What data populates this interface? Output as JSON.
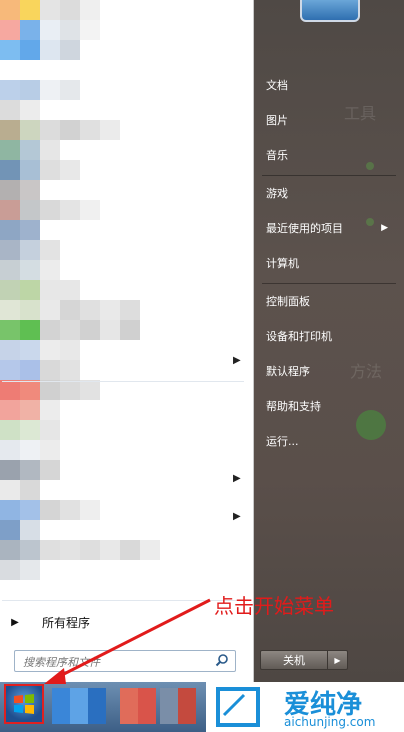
{
  "start_menu": {
    "all_programs": "所有程序",
    "search_placeholder": "搜索程序和文件",
    "right_items": [
      {
        "label": "文档"
      },
      {
        "label": "图片"
      },
      {
        "label": "音乐"
      },
      {
        "label": "游戏"
      },
      {
        "label": "最近使用的项目",
        "has_submenu": true
      },
      {
        "label": "计算机"
      },
      {
        "label": "控制面板"
      },
      {
        "label": "设备和打印机"
      },
      {
        "label": "默认程序"
      },
      {
        "label": "帮助和支持"
      },
      {
        "label": "运行..."
      }
    ],
    "shutdown_label": "关机"
  },
  "annotation": {
    "text": "点击开始菜单",
    "color": "#e11b1b"
  },
  "watermark": {
    "main": "爱纯净",
    "sub": "aichunjing.com"
  },
  "colors": {
    "right_pane": "#5a514c",
    "taskbar": "#3d5f86",
    "highlight": "#e02020"
  }
}
